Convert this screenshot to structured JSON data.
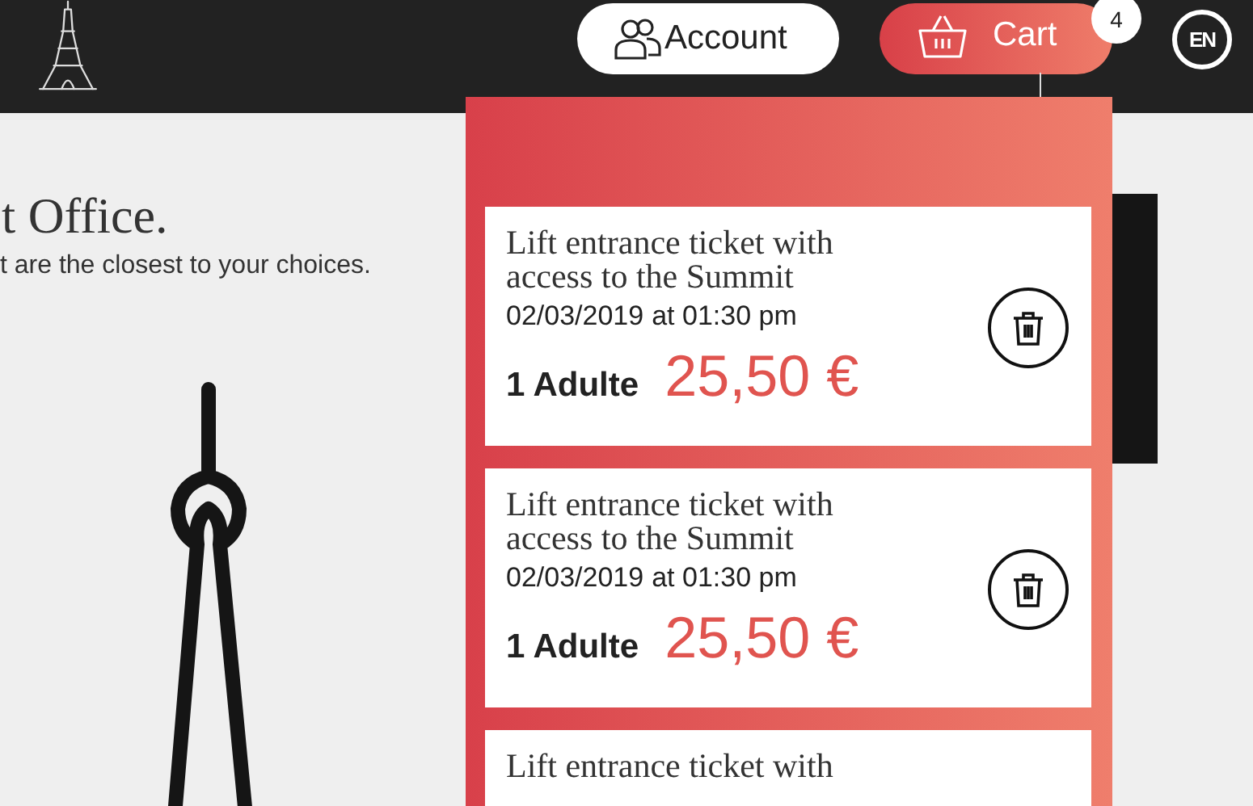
{
  "header": {
    "account_button": "Account",
    "cart_button": "Cart",
    "cart_count": "4",
    "language": "EN"
  },
  "page": {
    "heading": "t Office.",
    "subtitle": "t are the closest to your choices."
  },
  "cart": {
    "items": [
      {
        "title": "Lift entrance ticket with access to the Summit",
        "date": "02/03/2019",
        "time_label": "at 01:30 pm",
        "quantity": "1 Adulte",
        "price": "25,50 €"
      },
      {
        "title": "Lift entrance ticket with access to the Summit",
        "date": "02/03/2019",
        "time_label": "at 01:30 pm",
        "quantity": "1 Adulte",
        "price": "25,50 €"
      },
      {
        "title": "Lift entrance ticket with"
      }
    ]
  }
}
